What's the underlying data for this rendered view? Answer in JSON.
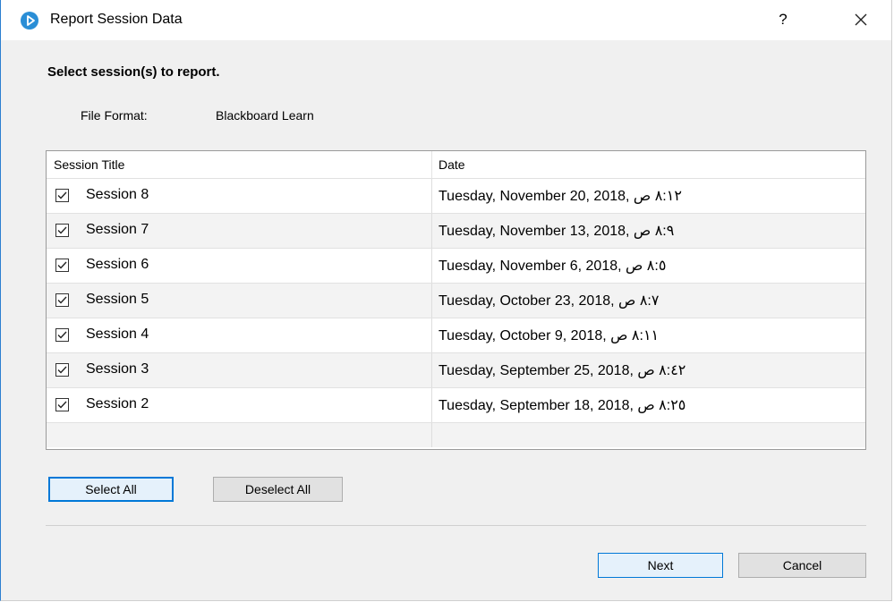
{
  "window": {
    "title": "Report Session Data",
    "help_label": "?",
    "icons": {
      "app": "play-circle-icon",
      "close": "close-icon",
      "checkbox": "checkbox-checked-icon"
    }
  },
  "form": {
    "prompt": "Select session(s) to report.",
    "file_format_label": "File Format:",
    "file_format_value": "Blackboard Learn"
  },
  "table": {
    "headers": [
      "Session Title",
      "Date"
    ],
    "rows": [
      {
        "title": "Session 8",
        "date": "Tuesday, November 20, 2018, ٨:١٢ ص",
        "checked": true
      },
      {
        "title": "Session 7",
        "date": "Tuesday, November 13, 2018, ٨:٩ ص",
        "checked": true
      },
      {
        "title": "Session 6",
        "date": "Tuesday, November 6, 2018, ٨:٥ ص",
        "checked": true
      },
      {
        "title": "Session 5",
        "date": "Tuesday, October 23, 2018, ٨:٧ ص",
        "checked": true
      },
      {
        "title": "Session 4",
        "date": "Tuesday, October 9, 2018, ٨:١١ ص",
        "checked": true
      },
      {
        "title": "Session 3",
        "date": "Tuesday, September 25, 2018, ٨:٤٢ ص",
        "checked": true
      },
      {
        "title": "Session 2",
        "date": "Tuesday, September 18, 2018, ٨:٢٥ ص",
        "checked": true
      }
    ]
  },
  "buttons": {
    "select_all": "Select All",
    "deselect_all": "Deselect All",
    "next": "Next",
    "cancel": "Cancel"
  },
  "colors": {
    "accent": "#0078d7",
    "app_icon": "#2a8ed6",
    "dialog_bg": "#f0f0f0"
  }
}
